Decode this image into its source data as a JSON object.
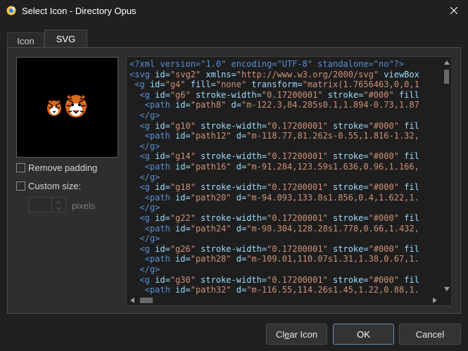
{
  "window": {
    "title": "Select Icon - Directory Opus",
    "app_icon": "directory-opus-icon",
    "close_icon": "close-icon"
  },
  "tabs": [
    {
      "label": "Icon",
      "active": false
    },
    {
      "label": "SVG",
      "active": true
    }
  ],
  "preview": {
    "images": [
      "tiger-icon-small",
      "tiger-icon-large"
    ]
  },
  "options": {
    "remove_padding": {
      "label": "Remove padding",
      "checked": false
    },
    "custom_size": {
      "label": "Custom size:",
      "checked": false
    },
    "size_value": "",
    "size_unit": "pixels"
  },
  "code": {
    "lines": [
      [
        [
          "#5a8fd6",
          "<?xml version=\"1.0\" encoding=\"UTF-8\" standalone=\"no\"?>"
        ]
      ],
      [
        [
          "#5a8fd6",
          "<svg "
        ],
        [
          "#9cdcfe",
          "id="
        ],
        [
          "#ce9178",
          "\"svg2\" "
        ],
        [
          "#9cdcfe",
          "xmlns="
        ],
        [
          "#ce9178",
          "\"http://www.w3.org/2000/svg\" "
        ],
        [
          "#9cdcfe",
          "viewBox"
        ]
      ],
      [
        [
          "#5a8fd6",
          " <g "
        ],
        [
          "#9cdcfe",
          "id="
        ],
        [
          "#ce9178",
          "\"g4\" "
        ],
        [
          "#9cdcfe",
          "fill="
        ],
        [
          "#ce9178",
          "\"none\" "
        ],
        [
          "#9cdcfe",
          "transform="
        ],
        [
          "#ce9178",
          "\"matrix(1.7656463,0,0,1"
        ]
      ],
      [
        [
          "#5a8fd6",
          "  <g "
        ],
        [
          "#9cdcfe",
          "id="
        ],
        [
          "#ce9178",
          "\"g6\" "
        ],
        [
          "#9cdcfe",
          "stroke-width="
        ],
        [
          "#ce9178",
          "\"0.17200001\" "
        ],
        [
          "#9cdcfe",
          "stroke="
        ],
        [
          "#ce9178",
          "\"#000\" "
        ],
        [
          "#9cdcfe",
          "fill"
        ]
      ],
      [
        [
          "#5a8fd6",
          "   <path "
        ],
        [
          "#9cdcfe",
          "id="
        ],
        [
          "#ce9178",
          "\"path8\" "
        ],
        [
          "#9cdcfe",
          "d="
        ],
        [
          "#ce9178",
          "\"m-122.3,84.285s0.1,1.894-0.73,1.87"
        ]
      ],
      [
        [
          "#5a8fd6",
          "  </g>"
        ]
      ],
      [
        [
          "#5a8fd6",
          "  <g "
        ],
        [
          "#9cdcfe",
          "id="
        ],
        [
          "#ce9178",
          "\"g10\" "
        ],
        [
          "#9cdcfe",
          "stroke-width="
        ],
        [
          "#ce9178",
          "\"0.17200001\" "
        ],
        [
          "#9cdcfe",
          "stroke="
        ],
        [
          "#ce9178",
          "\"#000\" "
        ],
        [
          "#9cdcfe",
          "fil"
        ]
      ],
      [
        [
          "#5a8fd6",
          "   <path "
        ],
        [
          "#9cdcfe",
          "id="
        ],
        [
          "#ce9178",
          "\"path12\" "
        ],
        [
          "#9cdcfe",
          "d="
        ],
        [
          "#ce9178",
          "\"m-118.77,81.262s-0.55,1.816-1.32,"
        ]
      ],
      [
        [
          "#5a8fd6",
          "  </g>"
        ]
      ],
      [
        [
          "#5a8fd6",
          "  <g "
        ],
        [
          "#9cdcfe",
          "id="
        ],
        [
          "#ce9178",
          "\"g14\" "
        ],
        [
          "#9cdcfe",
          "stroke-width="
        ],
        [
          "#ce9178",
          "\"0.17200001\" "
        ],
        [
          "#9cdcfe",
          "stroke="
        ],
        [
          "#ce9178",
          "\"#000\" "
        ],
        [
          "#9cdcfe",
          "fil"
        ]
      ],
      [
        [
          "#5a8fd6",
          "   <path "
        ],
        [
          "#9cdcfe",
          "id="
        ],
        [
          "#ce9178",
          "\"path16\" "
        ],
        [
          "#9cdcfe",
          "d="
        ],
        [
          "#ce9178",
          "\"m-91.284,123.59s1.636,0.96,1.166,"
        ]
      ],
      [
        [
          "#5a8fd6",
          "  </g>"
        ]
      ],
      [
        [
          "#5a8fd6",
          "  <g "
        ],
        [
          "#9cdcfe",
          "id="
        ],
        [
          "#ce9178",
          "\"g18\" "
        ],
        [
          "#9cdcfe",
          "stroke-width="
        ],
        [
          "#ce9178",
          "\"0.17200001\" "
        ],
        [
          "#9cdcfe",
          "stroke="
        ],
        [
          "#ce9178",
          "\"#000\" "
        ],
        [
          "#9cdcfe",
          "fil"
        ]
      ],
      [
        [
          "#5a8fd6",
          "   <path "
        ],
        [
          "#9cdcfe",
          "id="
        ],
        [
          "#ce9178",
          "\"path20\" "
        ],
        [
          "#9cdcfe",
          "d="
        ],
        [
          "#ce9178",
          "\"m-94.093,133.8s1.856,0.4,1.622,1."
        ]
      ],
      [
        [
          "#5a8fd6",
          "  </g>"
        ]
      ],
      [
        [
          "#5a8fd6",
          "  <g "
        ],
        [
          "#9cdcfe",
          "id="
        ],
        [
          "#ce9178",
          "\"g22\" "
        ],
        [
          "#9cdcfe",
          "stroke-width="
        ],
        [
          "#ce9178",
          "\"0.17200001\" "
        ],
        [
          "#9cdcfe",
          "stroke="
        ],
        [
          "#ce9178",
          "\"#000\" "
        ],
        [
          "#9cdcfe",
          "fil"
        ]
      ],
      [
        [
          "#5a8fd6",
          "   <path "
        ],
        [
          "#9cdcfe",
          "id="
        ],
        [
          "#ce9178",
          "\"path24\" "
        ],
        [
          "#9cdcfe",
          "d="
        ],
        [
          "#ce9178",
          "\"m-98.304,128.28s1.778,0.66,1.432,"
        ]
      ],
      [
        [
          "#5a8fd6",
          "  </g>"
        ]
      ],
      [
        [
          "#5a8fd6",
          "  <g "
        ],
        [
          "#9cdcfe",
          "id="
        ],
        [
          "#ce9178",
          "\"g26\" "
        ],
        [
          "#9cdcfe",
          "stroke-width="
        ],
        [
          "#ce9178",
          "\"0.17200001\" "
        ],
        [
          "#9cdcfe",
          "stroke="
        ],
        [
          "#ce9178",
          "\"#000\" "
        ],
        [
          "#9cdcfe",
          "fil"
        ]
      ],
      [
        [
          "#5a8fd6",
          "   <path "
        ],
        [
          "#9cdcfe",
          "id="
        ],
        [
          "#ce9178",
          "\"path28\" "
        ],
        [
          "#9cdcfe",
          "d="
        ],
        [
          "#ce9178",
          "\"m-109.01,110.07s1.31,1.38,0.67,1."
        ]
      ],
      [
        [
          "#5a8fd6",
          "  </g>"
        ]
      ],
      [
        [
          "#5a8fd6",
          "  <g "
        ],
        [
          "#9cdcfe",
          "id="
        ],
        [
          "#ce9178",
          "\"g30\" "
        ],
        [
          "#9cdcfe",
          "stroke-width="
        ],
        [
          "#ce9178",
          "\"0.17200001\" "
        ],
        [
          "#9cdcfe",
          "stroke="
        ],
        [
          "#ce9178",
          "\"#000\" "
        ],
        [
          "#9cdcfe",
          "fil"
        ]
      ],
      [
        [
          "#5a8fd6",
          "   <path "
        ],
        [
          "#9cdcfe",
          "id="
        ],
        [
          "#ce9178",
          "\"path32\" "
        ],
        [
          "#9cdcfe",
          "d="
        ],
        [
          "#ce9178",
          "\"m-116.55,114.26s1.45,1.22,0.88,1."
        ]
      ]
    ]
  },
  "buttons": {
    "clear_icon": {
      "prefix": "Cl",
      "accel": "e",
      "suffix": "ar Icon"
    },
    "ok": "OK",
    "cancel": "Cancel"
  },
  "colors": {
    "background": "#202020",
    "panel": "#2e2e2e",
    "code_bg": "#1e1e1e",
    "tag": "#5a8fd6",
    "attr_name": "#9cdcfe",
    "attr_value": "#ce9178",
    "ok_border": "#6a8caf"
  }
}
